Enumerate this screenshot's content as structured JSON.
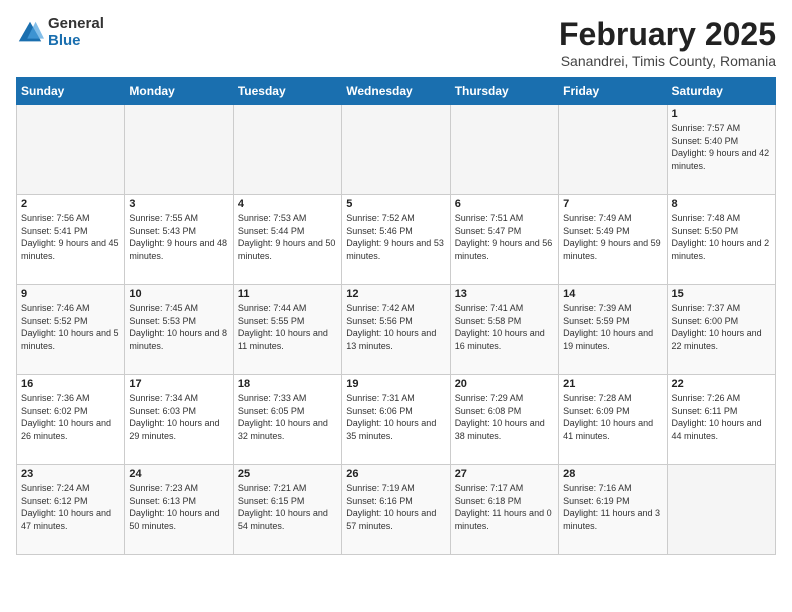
{
  "header": {
    "logo_general": "General",
    "logo_blue": "Blue",
    "title": "February 2025",
    "subtitle": "Sanandrei, Timis County, Romania"
  },
  "days_of_week": [
    "Sunday",
    "Monday",
    "Tuesday",
    "Wednesday",
    "Thursday",
    "Friday",
    "Saturday"
  ],
  "weeks": [
    [
      {
        "day": "",
        "info": ""
      },
      {
        "day": "",
        "info": ""
      },
      {
        "day": "",
        "info": ""
      },
      {
        "day": "",
        "info": ""
      },
      {
        "day": "",
        "info": ""
      },
      {
        "day": "",
        "info": ""
      },
      {
        "day": "1",
        "info": "Sunrise: 7:57 AM\nSunset: 5:40 PM\nDaylight: 9 hours and 42 minutes."
      }
    ],
    [
      {
        "day": "2",
        "info": "Sunrise: 7:56 AM\nSunset: 5:41 PM\nDaylight: 9 hours and 45 minutes."
      },
      {
        "day": "3",
        "info": "Sunrise: 7:55 AM\nSunset: 5:43 PM\nDaylight: 9 hours and 48 minutes."
      },
      {
        "day": "4",
        "info": "Sunrise: 7:53 AM\nSunset: 5:44 PM\nDaylight: 9 hours and 50 minutes."
      },
      {
        "day": "5",
        "info": "Sunrise: 7:52 AM\nSunset: 5:46 PM\nDaylight: 9 hours and 53 minutes."
      },
      {
        "day": "6",
        "info": "Sunrise: 7:51 AM\nSunset: 5:47 PM\nDaylight: 9 hours and 56 minutes."
      },
      {
        "day": "7",
        "info": "Sunrise: 7:49 AM\nSunset: 5:49 PM\nDaylight: 9 hours and 59 minutes."
      },
      {
        "day": "8",
        "info": "Sunrise: 7:48 AM\nSunset: 5:50 PM\nDaylight: 10 hours and 2 minutes."
      }
    ],
    [
      {
        "day": "9",
        "info": "Sunrise: 7:46 AM\nSunset: 5:52 PM\nDaylight: 10 hours and 5 minutes."
      },
      {
        "day": "10",
        "info": "Sunrise: 7:45 AM\nSunset: 5:53 PM\nDaylight: 10 hours and 8 minutes."
      },
      {
        "day": "11",
        "info": "Sunrise: 7:44 AM\nSunset: 5:55 PM\nDaylight: 10 hours and 11 minutes."
      },
      {
        "day": "12",
        "info": "Sunrise: 7:42 AM\nSunset: 5:56 PM\nDaylight: 10 hours and 13 minutes."
      },
      {
        "day": "13",
        "info": "Sunrise: 7:41 AM\nSunset: 5:58 PM\nDaylight: 10 hours and 16 minutes."
      },
      {
        "day": "14",
        "info": "Sunrise: 7:39 AM\nSunset: 5:59 PM\nDaylight: 10 hours and 19 minutes."
      },
      {
        "day": "15",
        "info": "Sunrise: 7:37 AM\nSunset: 6:00 PM\nDaylight: 10 hours and 22 minutes."
      }
    ],
    [
      {
        "day": "16",
        "info": "Sunrise: 7:36 AM\nSunset: 6:02 PM\nDaylight: 10 hours and 26 minutes."
      },
      {
        "day": "17",
        "info": "Sunrise: 7:34 AM\nSunset: 6:03 PM\nDaylight: 10 hours and 29 minutes."
      },
      {
        "day": "18",
        "info": "Sunrise: 7:33 AM\nSunset: 6:05 PM\nDaylight: 10 hours and 32 minutes."
      },
      {
        "day": "19",
        "info": "Sunrise: 7:31 AM\nSunset: 6:06 PM\nDaylight: 10 hours and 35 minutes."
      },
      {
        "day": "20",
        "info": "Sunrise: 7:29 AM\nSunset: 6:08 PM\nDaylight: 10 hours and 38 minutes."
      },
      {
        "day": "21",
        "info": "Sunrise: 7:28 AM\nSunset: 6:09 PM\nDaylight: 10 hours and 41 minutes."
      },
      {
        "day": "22",
        "info": "Sunrise: 7:26 AM\nSunset: 6:11 PM\nDaylight: 10 hours and 44 minutes."
      }
    ],
    [
      {
        "day": "23",
        "info": "Sunrise: 7:24 AM\nSunset: 6:12 PM\nDaylight: 10 hours and 47 minutes."
      },
      {
        "day": "24",
        "info": "Sunrise: 7:23 AM\nSunset: 6:13 PM\nDaylight: 10 hours and 50 minutes."
      },
      {
        "day": "25",
        "info": "Sunrise: 7:21 AM\nSunset: 6:15 PM\nDaylight: 10 hours and 54 minutes."
      },
      {
        "day": "26",
        "info": "Sunrise: 7:19 AM\nSunset: 6:16 PM\nDaylight: 10 hours and 57 minutes."
      },
      {
        "day": "27",
        "info": "Sunrise: 7:17 AM\nSunset: 6:18 PM\nDaylight: 11 hours and 0 minutes."
      },
      {
        "day": "28",
        "info": "Sunrise: 7:16 AM\nSunset: 6:19 PM\nDaylight: 11 hours and 3 minutes."
      },
      {
        "day": "",
        "info": ""
      }
    ]
  ]
}
